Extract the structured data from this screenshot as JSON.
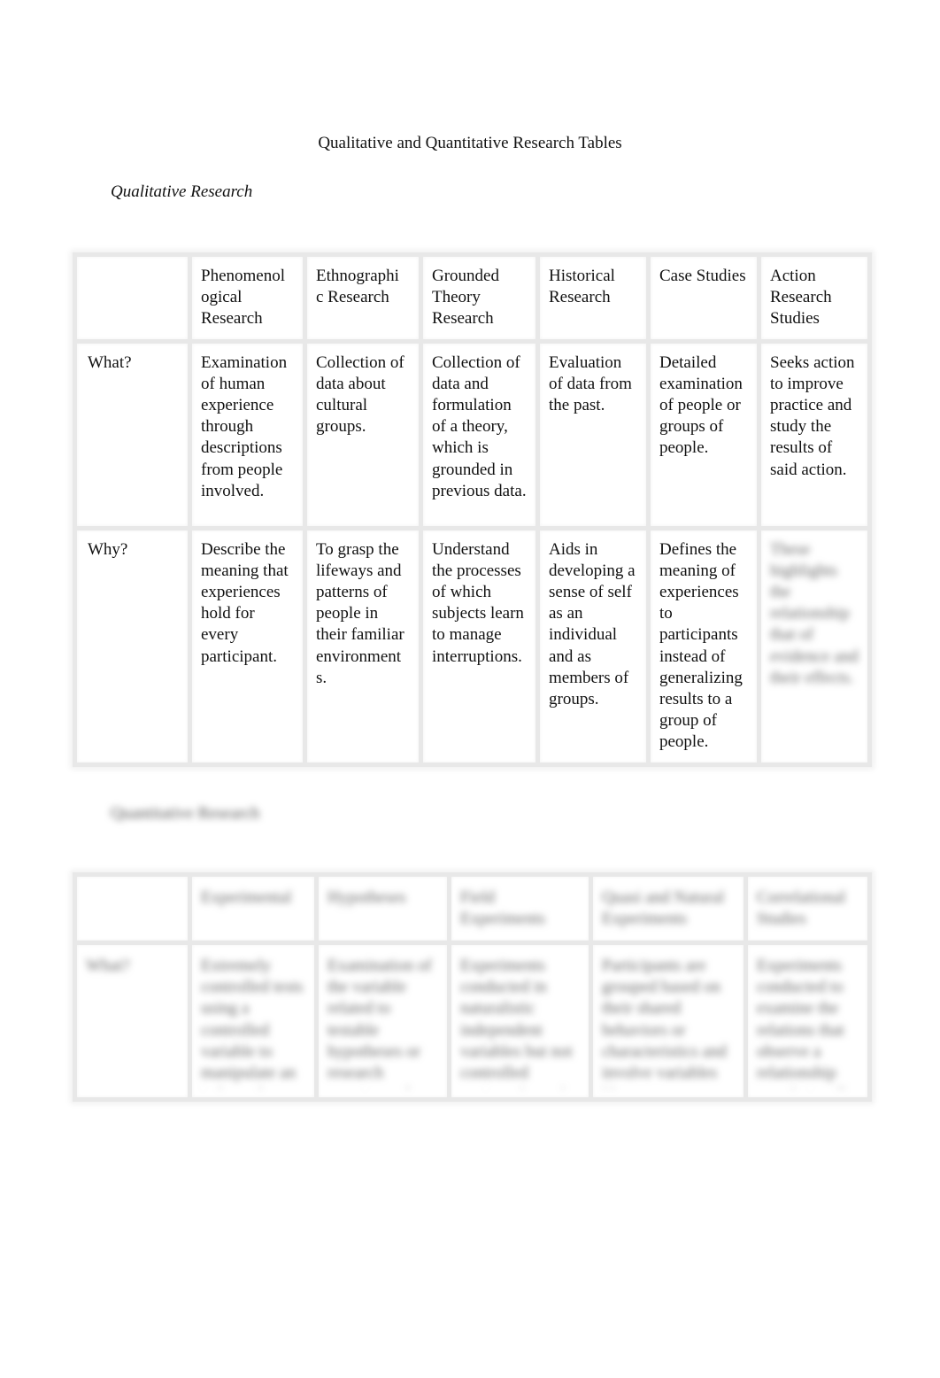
{
  "document": {
    "title": "Qualitative and Quantitative Research Tables"
  },
  "section1": {
    "heading": "Qualitative Research",
    "table": {
      "header": [
        "",
        "Phenomenological Research",
        "Ethnographic Research",
        "Grounded Theory Research",
        "Historical Research",
        "Case Studies",
        "Action Research Studies"
      ],
      "rows": [
        {
          "label": "What?",
          "cells": [
            "Examination of human experience through descriptions from people involved.",
            "Collection of data about cultural groups.",
            "Collection of data and formulation of a theory, which is grounded in previous data.",
            "Evaluation of data from the past.",
            "Detailed examination of people or groups of people.",
            "Seeks action to improve practice and study the results of said action."
          ]
        },
        {
          "label": "Why?",
          "cells": [
            "Describe the meaning that experiences hold for every participant.",
            "To grasp the lifeways and patterns of people in their familiar environments.",
            "Understand the processes of which subjects learn to manage interruptions.",
            "Aids in developing a sense of self as an individual and as members of groups.",
            "Defines the meaning of experiences to participants instead of generalizing results to a group of people.",
            "[blurred text]"
          ]
        }
      ]
    }
  },
  "section2": {
    "heading": "[blurred heading]",
    "table": {
      "header": [
        "",
        "[blurred]",
        "[blurred]",
        "[blurred]",
        "[blurred]",
        "[blurred]"
      ],
      "rows": [
        {
          "label": "[blurred]",
          "cells": [
            "[blurred text]",
            "[blurred text]",
            "[blurred text]",
            "[blurred text]",
            "[blurred text]"
          ]
        }
      ]
    }
  },
  "placeholders": {
    "blur_heading": "Quantitative Research",
    "blur_header": [
      "",
      "Experimental",
      "Hypotheses",
      "Field Experiments",
      "Quasi and Natural Experiments",
      "Correlational Studies"
    ],
    "blur_label": "What?",
    "blur_cells": [
      "Extremely controlled tests using a controlled variable to manipulate an independent",
      "Examination of the variable related to testable hypotheses or research questions of",
      "Experiments conducted in naturalistic independent variables but not controlled settings the real",
      "Participants are grouped based on their shared behaviors or characteristics and involve variables like an",
      "Experiments conducted to examine the relations that observe a relationship correlationally"
    ],
    "blur_why": "These highlights the relationship that of evidence and their effects."
  }
}
